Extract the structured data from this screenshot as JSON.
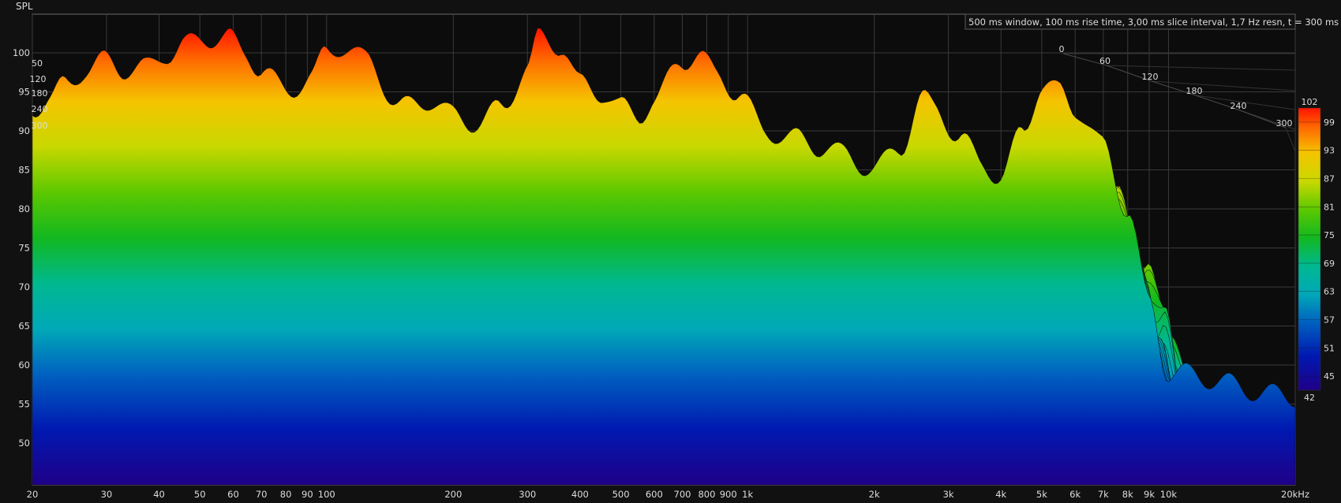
{
  "chart_data": {
    "type": "area",
    "title": "",
    "ylabel": "SPL",
    "xlabel": "",
    "info": "500 ms window, 100 ms rise time, 3,00 ms slice interval, 1,7 Hz resn, t = 300 ms",
    "x_scale": "log",
    "xlim": [
      20,
      20000
    ],
    "ylim": [
      44,
      102
    ],
    "grid": true,
    "x_ticks": [
      {
        "v": 20,
        "l": "20"
      },
      {
        "v": 30,
        "l": "30"
      },
      {
        "v": 40,
        "l": "40"
      },
      {
        "v": 50,
        "l": "50"
      },
      {
        "v": 60,
        "l": "60"
      },
      {
        "v": 70,
        "l": "70"
      },
      {
        "v": 80,
        "l": "80"
      },
      {
        "v": 90,
        "l": "90"
      },
      {
        "v": 100,
        "l": "100"
      },
      {
        "v": 200,
        "l": "200"
      },
      {
        "v": 300,
        "l": "300"
      },
      {
        "v": 400,
        "l": "400"
      },
      {
        "v": 500,
        "l": "500"
      },
      {
        "v": 600,
        "l": "600"
      },
      {
        "v": 700,
        "l": "700"
      },
      {
        "v": 800,
        "l": "800"
      },
      {
        "v": 900,
        "l": "900"
      },
      {
        "v": 1000,
        "l": "1k"
      },
      {
        "v": 2000,
        "l": "2k"
      },
      {
        "v": 3000,
        "l": "3k"
      },
      {
        "v": 4000,
        "l": "4k"
      },
      {
        "v": 5000,
        "l": "5k"
      },
      {
        "v": 6000,
        "l": "6k"
      },
      {
        "v": 7000,
        "l": "7k"
      },
      {
        "v": 8000,
        "l": "8k"
      },
      {
        "v": 9000,
        "l": "9k"
      },
      {
        "v": 10000,
        "l": "10k"
      },
      {
        "v": 20000,
        "l": "20kHz"
      }
    ],
    "y_ticks": [
      {
        "v": 100,
        "l": "100"
      },
      {
        "v": 95,
        "l": "95"
      },
      {
        "v": 90,
        "l": "90"
      },
      {
        "v": 85,
        "l": "85"
      },
      {
        "v": 80,
        "l": "80"
      },
      {
        "v": 75,
        "l": "75"
      },
      {
        "v": 70,
        "l": "70"
      },
      {
        "v": 65,
        "l": "65"
      },
      {
        "v": 60,
        "l": "60"
      },
      {
        "v": 55,
        "l": "55"
      },
      {
        "v": 50,
        "l": "50"
      }
    ],
    "time_axis_ms": [
      "0",
      "60",
      "120",
      "180",
      "240",
      "300"
    ],
    "time_axis_left_labels": [
      "50",
      "120",
      "180",
      "240",
      "300"
    ],
    "colorbar": {
      "min": 42,
      "max": 102,
      "ticks": [
        "102",
        "99",
        "93",
        "87",
        "81",
        "75",
        "69",
        "63",
        "57",
        "51",
        "45",
        "42"
      ]
    },
    "front_slice_t_ms": 300,
    "peaks": [
      {
        "f": 20,
        "db": 93
      },
      {
        "f": 22,
        "db": 94
      },
      {
        "f": 24,
        "db": 96
      },
      {
        "f": 27,
        "db": 98
      },
      {
        "f": 30,
        "db": 99
      },
      {
        "f": 33,
        "db": 98
      },
      {
        "f": 37,
        "db": 98
      },
      {
        "f": 42,
        "db": 100
      },
      {
        "f": 46,
        "db": 101
      },
      {
        "f": 52,
        "db": 102
      },
      {
        "f": 58,
        "db": 102
      },
      {
        "f": 64,
        "db": 100
      },
      {
        "f": 70,
        "db": 98
      },
      {
        "f": 80,
        "db": 95
      },
      {
        "f": 92,
        "db": 97
      },
      {
        "f": 100,
        "db": 100
      },
      {
        "f": 110,
        "db": 101
      },
      {
        "f": 125,
        "db": 99
      },
      {
        "f": 150,
        "db": 93
      },
      {
        "f": 175,
        "db": 94
      },
      {
        "f": 200,
        "db": 92
      },
      {
        "f": 230,
        "db": 91
      },
      {
        "f": 260,
        "db": 93
      },
      {
        "f": 300,
        "db": 98
      },
      {
        "f": 320,
        "db": 102
      },
      {
        "f": 360,
        "db": 101
      },
      {
        "f": 400,
        "db": 96
      },
      {
        "f": 450,
        "db": 95
      },
      {
        "f": 500,
        "db": 93
      },
      {
        "f": 550,
        "db": 92
      },
      {
        "f": 600,
        "db": 94
      },
      {
        "f": 700,
        "db": 99
      },
      {
        "f": 760,
        "db": 100
      },
      {
        "f": 850,
        "db": 97
      },
      {
        "f": 950,
        "db": 95
      },
      {
        "f": 1100,
        "db": 90
      },
      {
        "f": 1300,
        "db": 89
      },
      {
        "f": 1500,
        "db": 88
      },
      {
        "f": 1700,
        "db": 87
      },
      {
        "f": 2000,
        "db": 85
      },
      {
        "f": 2300,
        "db": 88
      },
      {
        "f": 2600,
        "db": 94
      },
      {
        "f": 2800,
        "db": 93
      },
      {
        "f": 3200,
        "db": 89
      },
      {
        "f": 3600,
        "db": 86
      },
      {
        "f": 4000,
        "db": 84
      },
      {
        "f": 4500,
        "db": 90
      },
      {
        "f": 5000,
        "db": 96
      },
      {
        "f": 5500,
        "db": 95
      },
      {
        "f": 6000,
        "db": 93
      },
      {
        "f": 7000,
        "db": 88
      },
      {
        "f": 8000,
        "db": 80
      },
      {
        "f": 9000,
        "db": 68
      },
      {
        "f": 10000,
        "db": 59
      },
      {
        "f": 20000,
        "db": 56
      }
    ]
  }
}
